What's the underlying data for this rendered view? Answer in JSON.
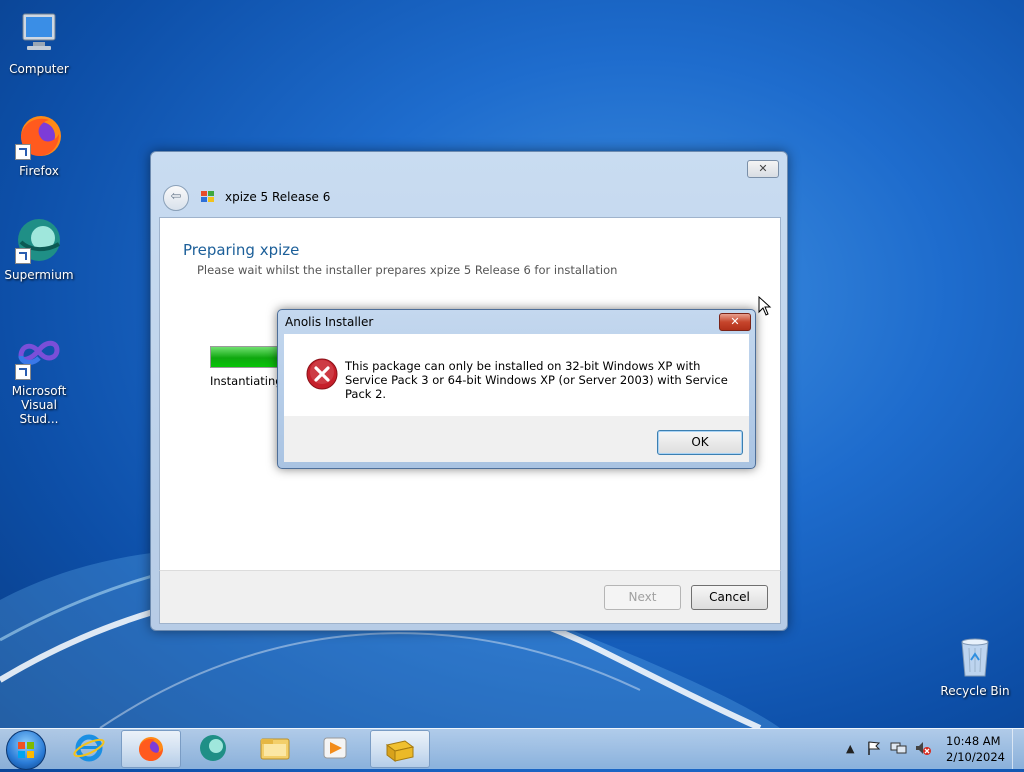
{
  "desktop": {
    "icons": [
      {
        "label": "Computer"
      },
      {
        "label": "Firefox"
      },
      {
        "label": "Supermium"
      },
      {
        "label": "Microsoft Visual Stud..."
      },
      {
        "label": "Recycle Bin"
      }
    ]
  },
  "installer": {
    "title": "xpize 5 Release 6",
    "close_glyph": "✕",
    "back_glyph": "⇦",
    "heading": "Preparing xpize",
    "subheading": "Please wait whilst the installer prepares xpize 5 Release 6 for installation",
    "status": "Instantiating",
    "progress_fraction": 0.85,
    "next_label": "Next",
    "cancel_label": "Cancel"
  },
  "dialog": {
    "title": "Anolis Installer",
    "close_glyph": "✕",
    "message": "This package can only be installed on 32-bit Windows XP with Service Pack 3 or 64-bit Windows XP (or Server 2003) with Service Pack 2.",
    "ok_label": "OK",
    "icon": "error-icon"
  },
  "taskbar": {
    "items": [
      "start-orb",
      "internet-explorer-icon",
      "firefox-icon",
      "supermium-icon",
      "file-explorer-icon",
      "media-player-icon",
      "installer-icon"
    ],
    "active_item": "firefox-icon",
    "tray_icons": [
      "show-hidden-icons",
      "action-center-flag-icon",
      "network-icon",
      "volume-muted-icon"
    ],
    "time": "10:48 AM",
    "date": "2/10/2024"
  },
  "colors": {
    "heading": "#1c5f99",
    "progress_green": "#0fa80f",
    "error_red": "#c6202b"
  }
}
